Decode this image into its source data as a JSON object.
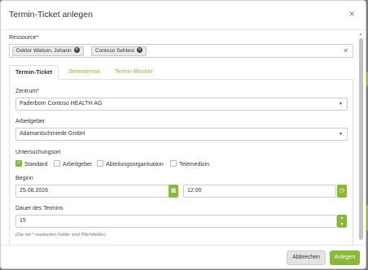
{
  "modal": {
    "title": "Termin-Ticket anlegen"
  },
  "resource": {
    "label": "Ressource*",
    "chips": [
      "Doktor Watson, Johann",
      "Contoso Sehtest"
    ]
  },
  "tabs": [
    "Termin-Ticket",
    "Serientermin",
    "Termin-Blocker"
  ],
  "form": {
    "zentrum_label": "Zentrum*",
    "zentrum_value": "Paderborn Contoso HEALTH AG",
    "arbeitgeber_label": "Arbeitgeber",
    "arbeitgeber_value": "Adamantschmiede GmbH",
    "ort_label": "Untersuchungsort",
    "ort_options": [
      "Standard",
      "Arbeitgeber",
      "Abteilungsorganisation",
      "Telemedizin"
    ],
    "ort_checked": "Standard",
    "beginn_label": "Beginn",
    "beginn_date": "25.08.2026",
    "beginn_time": "12:00",
    "dauer_label": "Dauer des Termins",
    "dauer_value": "15",
    "hint": "(Die mit * markierten Felder sind Pflichtfelder)"
  },
  "footer": {
    "cancel": "Abbrechen",
    "apply": "Anlegen"
  },
  "colors": {
    "accent": "#8ab93a",
    "backdrop": "#7a7a7a"
  }
}
